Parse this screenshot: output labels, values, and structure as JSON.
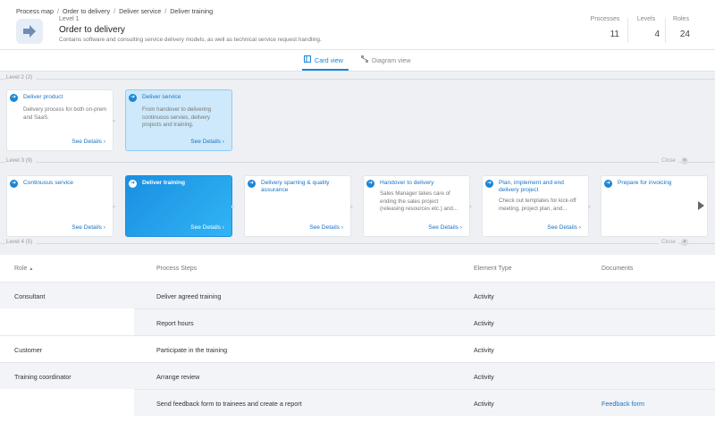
{
  "breadcrumb": [
    "Process map",
    "Order to delivery",
    "Deliver service",
    "Deliver training"
  ],
  "header": {
    "level": "Level 1",
    "title": "Order to delivery",
    "description": "Contains software and consulting service delivery models, as well as technical service request handling.",
    "stats": [
      {
        "label": "Processes",
        "value": "11"
      },
      {
        "label": "Levels",
        "value": "4"
      },
      {
        "label": "Roles",
        "value": "24"
      }
    ]
  },
  "tabs": {
    "card_view": "Card view",
    "diagram_view": "Diagram view"
  },
  "levels": {
    "level2": "Level 2 (2)",
    "level3": "Level 3 (9)",
    "level4": "Level 4 (5)",
    "close": "Close"
  },
  "see_details": "See Details",
  "level2_cards": [
    {
      "title": "Deliver product",
      "desc": "Delivery process for both on-prem and SaaS."
    },
    {
      "title": "Deliver service",
      "desc": "From handover to delivering continuous servies, delivery projects and training."
    }
  ],
  "level3_cards": [
    {
      "title": "Continuous service",
      "desc": ""
    },
    {
      "title": "Deliver training",
      "desc": ""
    },
    {
      "title": "Delivery sparring & quality assurance",
      "desc": ""
    },
    {
      "title": "Handover to delivery",
      "desc": "Sales Manager takes care of ending the sales project (releasing resources etc.) and..."
    },
    {
      "title": "Plan, implement and end delivery project",
      "desc": "Check out templates for kick-off meeting, project plan, and..."
    },
    {
      "title": "Prepare for invoicing",
      "desc": ""
    }
  ],
  "table": {
    "headers": {
      "role": "Role",
      "steps": "Process Steps",
      "type": "Element Type",
      "docs": "Documents"
    },
    "rows": [
      {
        "role": "Consultant",
        "step": "Deliver agreed training",
        "type": "Activity",
        "doc": ""
      },
      {
        "role": "",
        "step": "Report hours",
        "type": "Activity",
        "doc": ""
      },
      {
        "role": "Customer",
        "step": "Participate in the training",
        "type": "Activity",
        "doc": ""
      },
      {
        "role": "Training coordinator",
        "step": "Arrange review",
        "type": "Activity",
        "doc": ""
      },
      {
        "role": "",
        "step": "Send feedback form to trainees and create a report",
        "type": "Activity",
        "doc": "Feedback form"
      }
    ]
  },
  "colors": {
    "accent": "#1a86d6",
    "link": "#1a73c4"
  }
}
